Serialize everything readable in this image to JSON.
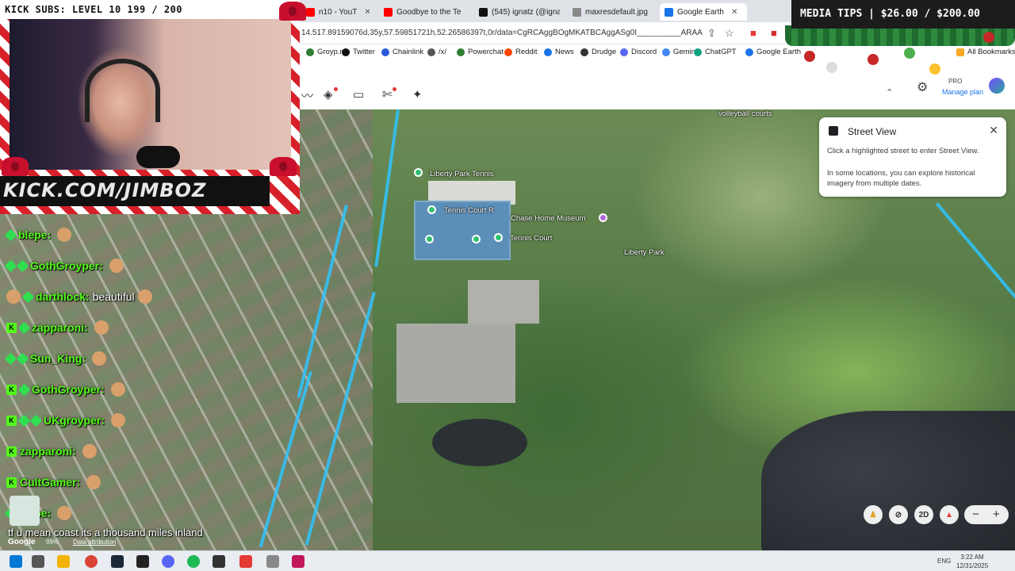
{
  "browser": {
    "tabs": [
      {
        "label": "n10 - YouT",
        "color": "#ff0000",
        "active": false
      },
      {
        "label": "Goodbye to the Te",
        "color": "#ff0000",
        "active": false
      },
      {
        "label": "(545) ignatz (@igna",
        "color": "#111111",
        "active": false
      },
      {
        "label": "maxresdefault.jpg",
        "color": "#888888",
        "active": false
      },
      {
        "label": "Google Earth",
        "color": "#1a73e8",
        "active": true
      }
    ],
    "url": "14.517.89159076d,35y,57.59851721h,52.26586397t,0r/data=CgRCAggBOgMKATBCAggASg0I__________ARAA",
    "bookmarks": [
      {
        "label": "Groyp.me",
        "color": "#2e7d32"
      },
      {
        "label": "Twitter",
        "color": "#111111"
      },
      {
        "label": "Chainlink",
        "color": "#2a5ada"
      },
      {
        "label": "/x/",
        "color": "#555555"
      },
      {
        "label": "Powerchat",
        "color": "#2e7d32"
      },
      {
        "label": "Reddit",
        "color": "#ff4500"
      },
      {
        "label": "News",
        "color": "#1a73e8"
      },
      {
        "label": "Drudge",
        "color": "#333333"
      },
      {
        "label": "Discord",
        "color": "#5865f2"
      },
      {
        "label": "Gemini",
        "color": "#4285f4"
      },
      {
        "label": "ChatGPT",
        "color": "#10a37f"
      },
      {
        "label": "Google Earth",
        "color": "#1a73e8"
      }
    ],
    "all_bookmarks": "All Bookmarks"
  },
  "earth": {
    "pro_label": "PRO",
    "manage_plan": "Manage plan",
    "tools": [
      "measure-icon",
      "layers-icon",
      "ruler-icon",
      "projects-icon",
      "sparkle-icon"
    ],
    "street_view": {
      "title": "Street View",
      "line1": "Click a highlighted street to enter Street View.",
      "line2": "In some locations, you can explore historical imagery from multiple dates."
    },
    "labels": {
      "volleyball": "volleyball courts",
      "tennis": "Liberty Park Tennis",
      "tennis_court_1": "Tennis Court R",
      "tennis_court_2": "Tennis Court",
      "museum": "Chase Home Museum",
      "park": "Liberty Park"
    },
    "controls": {
      "mode_2d": "2D",
      "zoom_out": "−",
      "zoom_in": "+"
    },
    "google": "Google",
    "zoom_pct": "99%",
    "data_attribution": "Data attribution"
  },
  "overlay": {
    "kick_subs": "KICK SUBS: LEVEL 10 199 / 200",
    "kick_url": "KICK.COM/JIMBOZ",
    "media_tips": "MEDIA TIPS | $26.00 / $200.00",
    "chat": [
      {
        "user": "blepe:",
        "msg": "",
        "badges": [
          "d"
        ]
      },
      {
        "user": "GothGroyper:",
        "msg": "",
        "badges": [
          "d",
          "d"
        ]
      },
      {
        "user": "darthlock:",
        "msg": "beautiful",
        "badges": [
          "e",
          "d"
        ]
      },
      {
        "user": "zapparoni:",
        "msg": "",
        "badges": [
          "k",
          "d"
        ]
      },
      {
        "user": "Sun_King:",
        "msg": "",
        "badges": [
          "d",
          "d"
        ]
      },
      {
        "user": "GothGroyper:",
        "msg": "",
        "badges": [
          "k",
          "d"
        ]
      },
      {
        "user": "UKgroyper:",
        "msg": "",
        "badges": [
          "k",
          "d",
          "d"
        ]
      },
      {
        "user": "zapparoni:",
        "msg": "",
        "badges": [
          "k"
        ]
      },
      {
        "user": "CultGamer:",
        "msg": "",
        "badges": [
          "k"
        ]
      },
      {
        "user": "blepe:",
        "msg": "",
        "badges": [
          "d"
        ]
      }
    ],
    "caption": "tf u mean coast its a thousand miles inland"
  },
  "taskbar": {
    "lang": "ENG",
    "time": "3:22 AM",
    "date": "12/31/2025"
  }
}
